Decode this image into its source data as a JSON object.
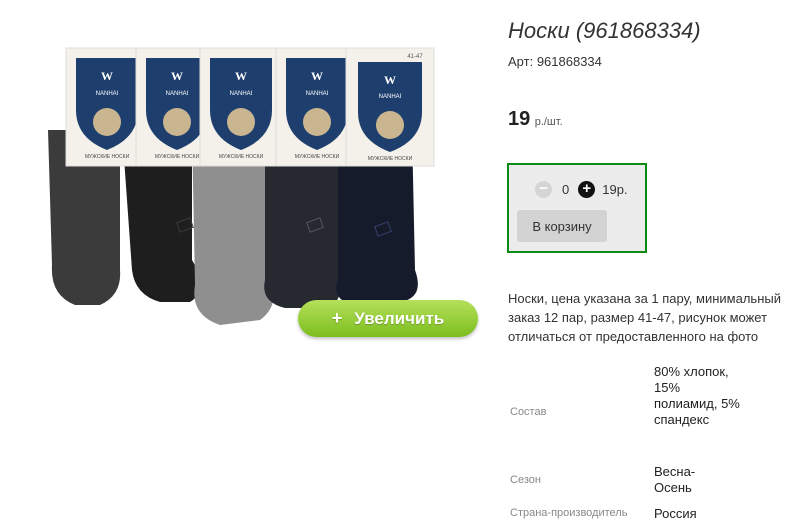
{
  "product": {
    "title": "Носки (961868334)",
    "sku_label": "Арт:",
    "sku": "961868334",
    "price": "19",
    "price_unit": "р./шт.",
    "zoom_label": "Увеличить",
    "packaging_brand": "NANHAI",
    "packaging_text": "МУЖСКИЕ НОСКИ",
    "packaging_size": "41-47"
  },
  "cart": {
    "minus": "−",
    "quantity": "0",
    "plus": "+",
    "total": "19р.",
    "button_label": "В корзину"
  },
  "description": "Носки, цена указана за 1 пару, минимальный заказ 12 пар, размер 41-47, рисунок может отличаться от предоставленного на фото",
  "properties": [
    {
      "key": "Состав",
      "value": "80% хлопок, 15% полиамид, 5% спандекс"
    },
    {
      "key": "Сезон",
      "value": "Весна-Осень"
    },
    {
      "key": "Страна-производитель",
      "value": "Россия"
    }
  ],
  "colors": {
    "cart_border": "#0d8a16",
    "zoom_button": "#8cc63f"
  }
}
